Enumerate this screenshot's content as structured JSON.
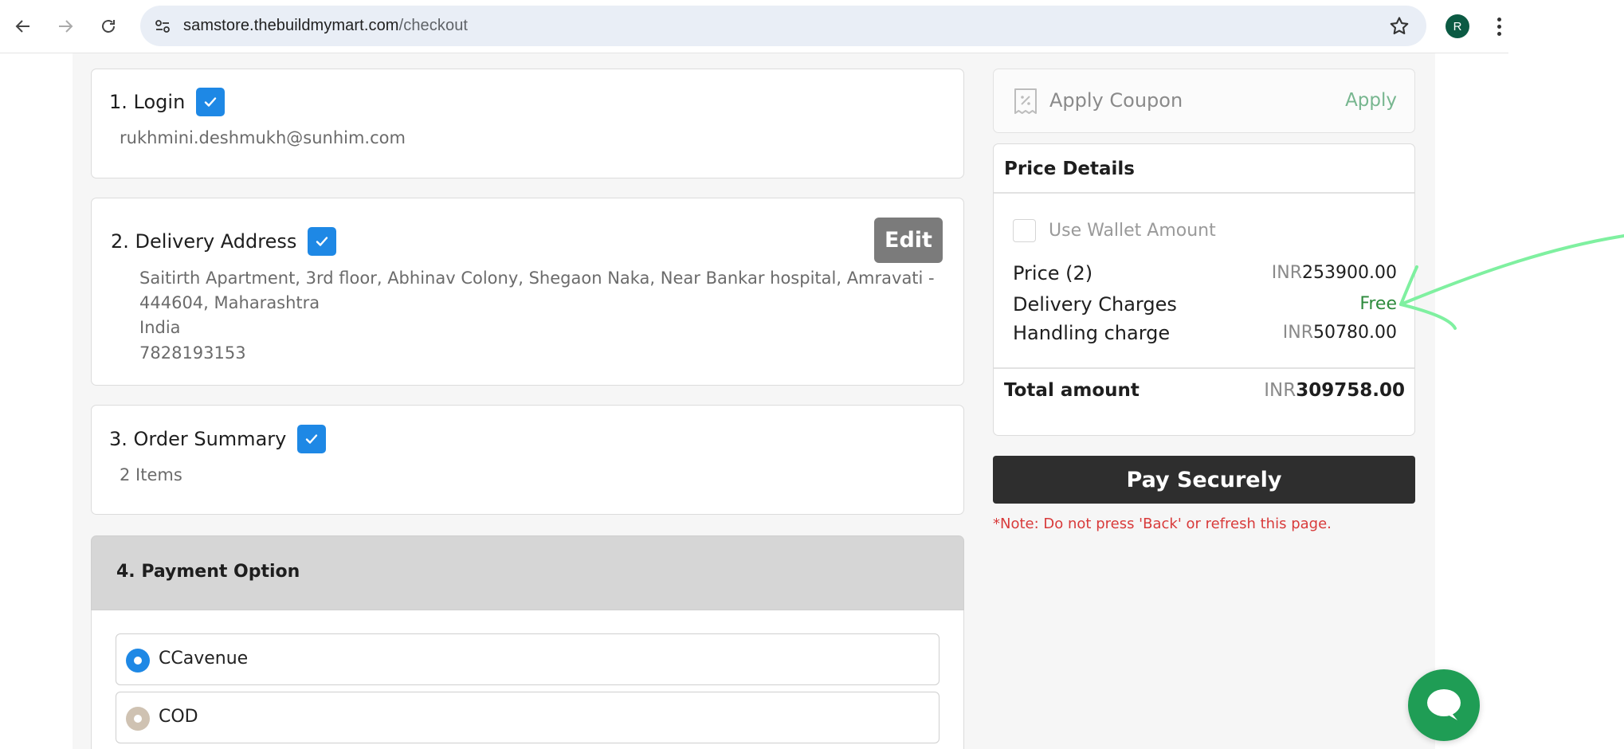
{
  "browser": {
    "url_host": "samstore.thebuildmymart.com",
    "url_path": "/checkout",
    "profile_initial": "R"
  },
  "login": {
    "title": "1. Login",
    "email": "rukhmini.deshmukh@sunhim.com"
  },
  "delivery": {
    "title": "2. Delivery Address",
    "edit_label": "Edit",
    "address_line1": "Saitirth Apartment, 3rd floor, Abhinav Colony, Shegaon Naka, Near Bankar hospital, Amravati -",
    "address_line2": "444604, Maharashtra",
    "country": "India",
    "phone": "7828193153"
  },
  "order_summary": {
    "title": "3. Order Summary",
    "items": "2 Items"
  },
  "payment": {
    "title": "4. Payment Option",
    "options": [
      {
        "label": "CCavenue",
        "selected": true
      },
      {
        "label": "COD",
        "selected": false
      }
    ]
  },
  "coupon": {
    "label": "Apply Coupon",
    "apply_label": "Apply"
  },
  "price_details": {
    "title": "Price Details",
    "wallet_label": "Use Wallet Amount",
    "currency": "INR",
    "rows": [
      {
        "label": "Price (2)",
        "value": "253900.00"
      },
      {
        "label": "Delivery Charges",
        "value": "Free"
      },
      {
        "label": "Handling charge",
        "value": "50780.00"
      }
    ],
    "total_label": "Total amount",
    "total_value": "309758.00"
  },
  "pay_button": "Pay Securely",
  "note": "*Note: Do not press 'Back' or refresh this page.",
  "colors": {
    "accent_blue": "#1e88e5",
    "free_green": "#2e8b3d",
    "note_red": "#d83a3a",
    "pay_button_bg": "#2e2e2e",
    "annotation_green": "#7ff0a0",
    "chat_green": "#1f9d55"
  }
}
